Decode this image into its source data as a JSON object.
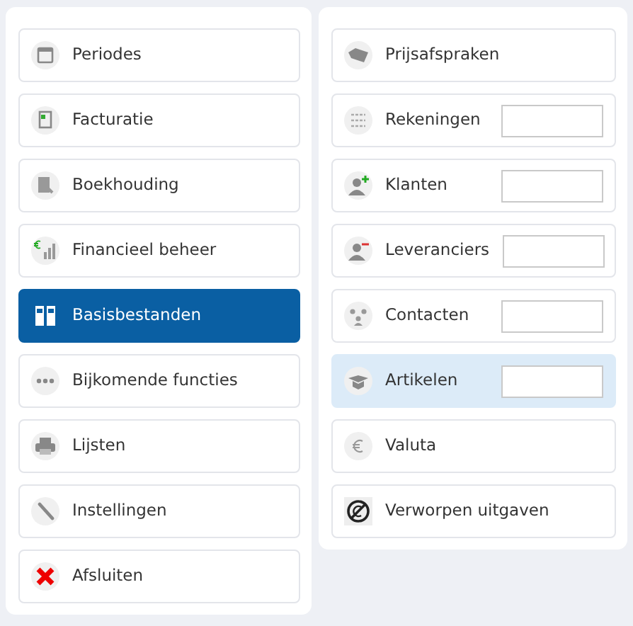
{
  "menu": [
    {
      "label": "Periodes",
      "selected": false
    },
    {
      "label": "Facturatie",
      "selected": false
    },
    {
      "label": "Boekhouding",
      "selected": false
    },
    {
      "label": "Financieel beheer",
      "selected": false
    },
    {
      "label": "Basisbestanden",
      "selected": true
    },
    {
      "label": "Bijkomende functies",
      "selected": false
    },
    {
      "label": "Lijsten",
      "selected": false
    },
    {
      "label": "Instellingen",
      "selected": false
    },
    {
      "label": "Afsluiten",
      "selected": false
    }
  ],
  "submenu": [
    {
      "label": "Prijsafspraken",
      "kind": "plain",
      "selected": false
    },
    {
      "label": "Rekeningen",
      "kind": "field",
      "selected": false
    },
    {
      "label": "Klanten",
      "kind": "field",
      "selected": false
    },
    {
      "label": "Leveranciers",
      "kind": "field",
      "selected": false
    },
    {
      "label": "Contacten",
      "kind": "field",
      "selected": false
    },
    {
      "label": "Artikelen",
      "kind": "field",
      "selected": true
    },
    {
      "label": "Valuta",
      "kind": "plain",
      "selected": false
    },
    {
      "label": "Verworpen uitgaven",
      "kind": "plain",
      "selected": false
    }
  ]
}
